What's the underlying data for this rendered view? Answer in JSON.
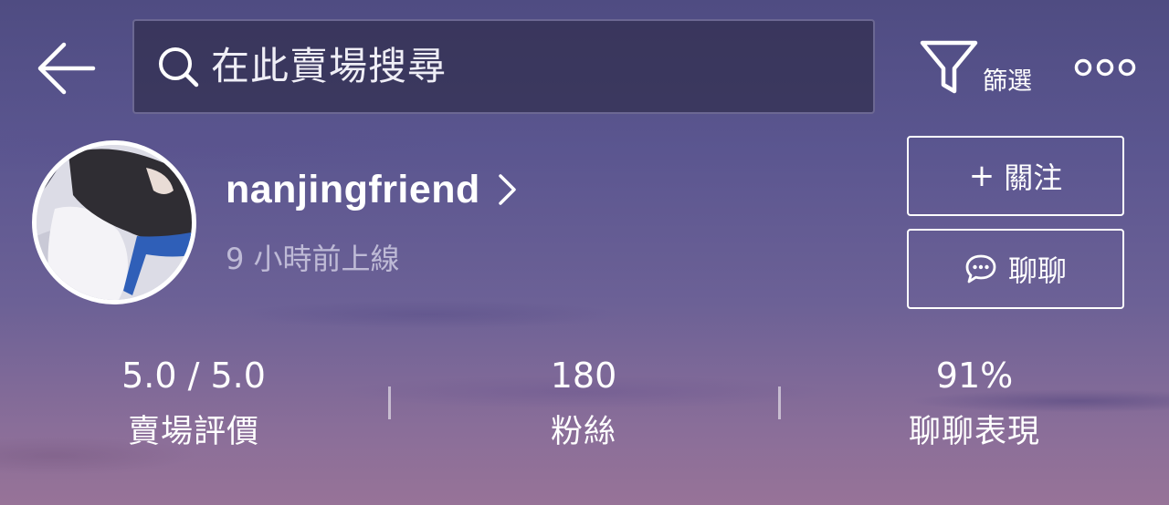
{
  "header": {
    "back_icon": "arrow-left-icon",
    "search": {
      "icon": "search-icon",
      "placeholder": "在此賣場搜尋"
    },
    "filter": {
      "icon": "filter-funnel-icon",
      "label": "篩選"
    },
    "more_icon": "more-dots-icon"
  },
  "profile": {
    "username": "nanjingfriend",
    "last_online": "9 小時前上線",
    "follow_button": {
      "plus": "+",
      "label": "關注"
    },
    "chat_button": {
      "icon": "chat-bubble-icon",
      "label": "聊聊"
    }
  },
  "stats": [
    {
      "value": "5.0 / 5.0",
      "label": "賣場評價"
    },
    {
      "value": "180",
      "label": "粉絲"
    },
    {
      "value": "91%",
      "label": "聊聊表現"
    }
  ],
  "colors": {
    "background_top": "#4f4c82",
    "background_bottom": "#977398",
    "text": "#ffffff",
    "muted_text": "#e1def0",
    "search_fill": "#302e4e"
  }
}
